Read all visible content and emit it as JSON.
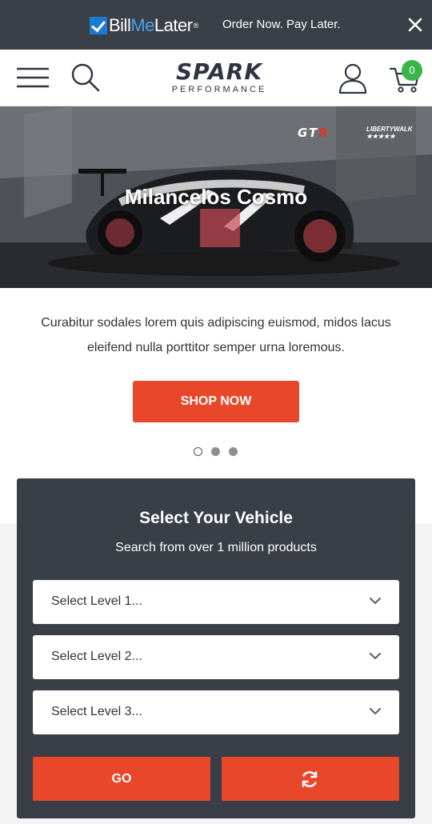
{
  "promo": {
    "logo_part1": "Bill",
    "logo_part2": "Me",
    "logo_part3": "Later",
    "logo_mark": "®",
    "text": "Order Now. Pay Later.",
    "close_icon": "close-icon"
  },
  "header": {
    "brand_name": "SPARK",
    "brand_tagline": "PERFORMANCE",
    "cart_count": "0",
    "icons": [
      "hamburger-menu-icon",
      "search-icon",
      "account-icon",
      "cart-icon"
    ]
  },
  "hero": {
    "title": "Milancelos Cosmo",
    "logo_left": "GT",
    "logo_right": "R",
    "logo_sub_line1": "LIBERTYWALK",
    "logo_sub_line2": "★★★★★"
  },
  "slide": {
    "description": "Curabitur sodales lorem quis adipiscing euismod, midos lacus eleifend nulla porttitor semper urna loremous.",
    "cta_label": "SHOP NOW",
    "dots": 3,
    "active_dot": 1
  },
  "vehicle": {
    "title": "Select Your Vehicle",
    "subtitle": "Search from over 1 million products",
    "level1": "Select Level 1...",
    "level2": "Select Level 2...",
    "level3": "Select Level 3...",
    "go_label": "GO",
    "reset_icon": "refresh-icon"
  },
  "colors": {
    "promo_bg": "#3a3f48",
    "accent": "#e8472a",
    "panel_bg": "#393e47",
    "cart_badge": "#3bb54a",
    "billmelater_blue": "#4aa3ec"
  }
}
